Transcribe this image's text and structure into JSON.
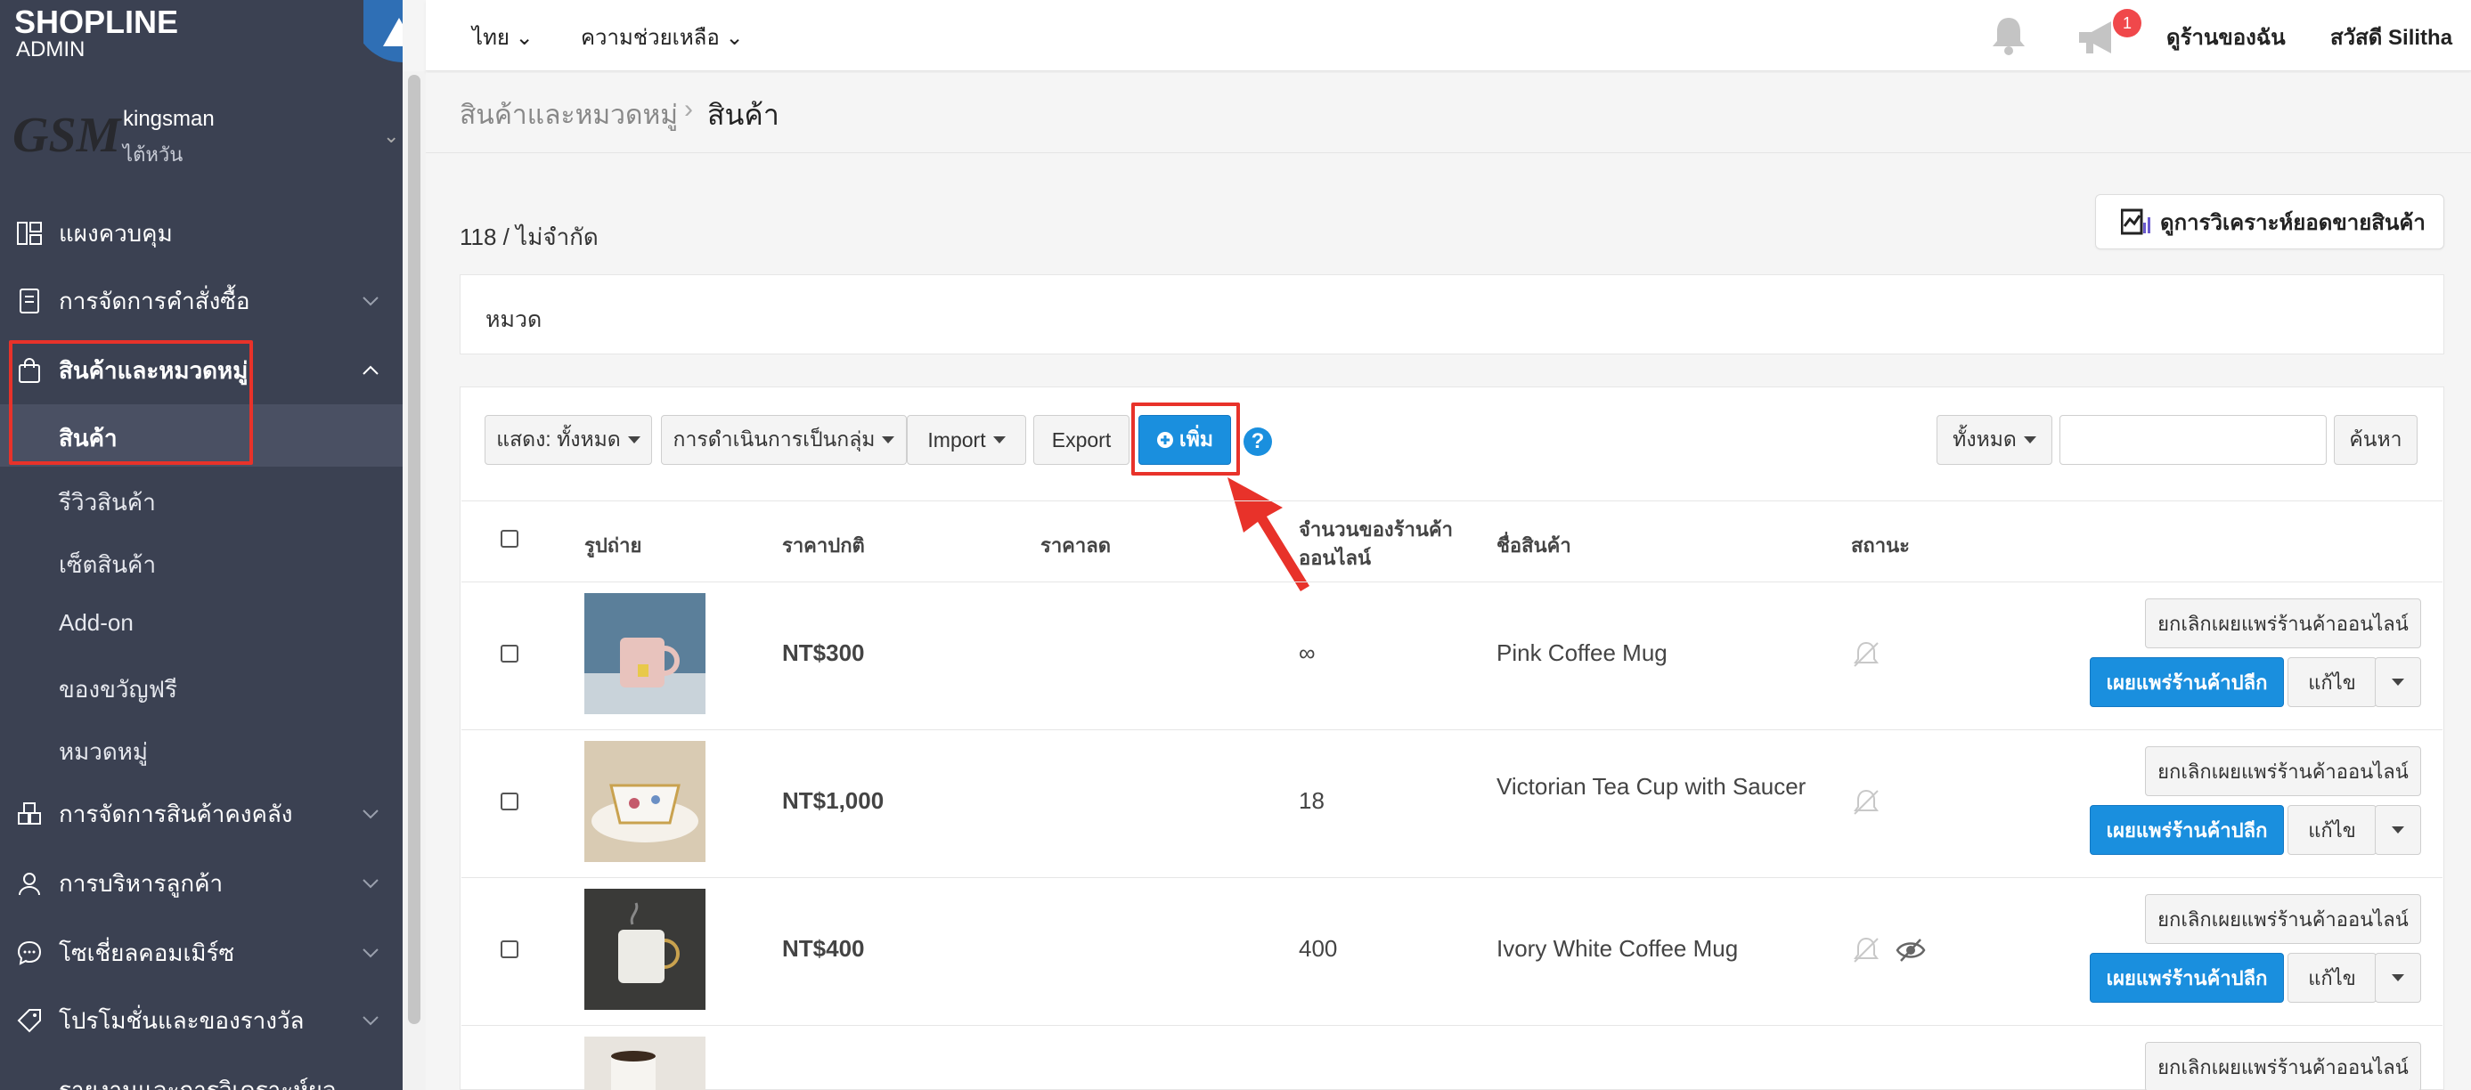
{
  "brand": {
    "logo": "SHOPLINE",
    "sub": "ADMIN"
  },
  "store": {
    "logo_text": "GSM",
    "name": "kingsman",
    "region": "ไต้หวัน"
  },
  "nav": {
    "dashboard": "แผงควบคุม",
    "orders": "การจัดการคำสั่งซื้อ",
    "products": "สินค้าและหมวดหมู่",
    "products_sub": [
      "สินค้า",
      "รีวิวสินค้า",
      "เซ็ตสินค้า",
      "Add-on",
      "ของขวัญฟรี",
      "หมวดหมู่"
    ],
    "inventory": "การจัดการสินค้าคงคลัง",
    "customers": "การบริหารลูกค้า",
    "social": "โซเชี่ยลคอมเมิร์ซ",
    "promotions": "โปรโมชั่นและของรางวัล",
    "reports": "รายงานและการวิเคราะห์ผล"
  },
  "topbar": {
    "language": "ไทย",
    "help": "ความช่วยเหลือ",
    "notification_count": "1",
    "my_store": "ดูร้านของฉัน",
    "greeting": "สวัสดี Silitha"
  },
  "breadcrumb": {
    "root": "สินค้าและหมวดหมู่",
    "sep": "›",
    "current": "สินค้า"
  },
  "summary": {
    "count": "118 / ไม่จำกัด",
    "analysis_button": "ดูการวิเคราะห์ยอดขายสินค้า",
    "category_label": "หมวด"
  },
  "toolbar": {
    "show": "แสดง: ทั้งหมด",
    "bulk": "การดำเนินการเป็นกลุ่ม",
    "import": "Import",
    "export": "Export",
    "add": "เพิ่ม",
    "help": "?",
    "filter": "ทั้งหมด",
    "search_button": "ค้นหา",
    "search_placeholder": ""
  },
  "table": {
    "headers": {
      "photo": "รูปถ่าย",
      "price": "ราคาปกติ",
      "sale_price": "ราคาลด",
      "online_qty_1": "จำนวนของร้านค้า",
      "online_qty_2": "ออนไลน์",
      "name": "ชื่อสินค้า",
      "status": "สถานะ"
    },
    "actions": {
      "unpublish": "ยกเลิกเผยแพร่ร้านค้าออนไลน์",
      "publish_retail": "เผยแพร่ร้านค้าปลีก",
      "edit": "แก้ไข"
    },
    "rows": [
      {
        "price": "NT$300",
        "qty": "∞",
        "name": "Pink Coffee Mug"
      },
      {
        "price": "NT$1,000",
        "qty": "18",
        "name": "Victorian Tea Cup with Saucer"
      },
      {
        "price": "NT$400",
        "qty": "400",
        "name": "Ivory White Coffee Mug"
      },
      {
        "price": "",
        "qty": "",
        "name": ""
      }
    ]
  },
  "colors": {
    "sidebar": "#3b4152",
    "primary": "#1a8fde",
    "highlight": "#e8322a",
    "badge": "#f0484b"
  }
}
